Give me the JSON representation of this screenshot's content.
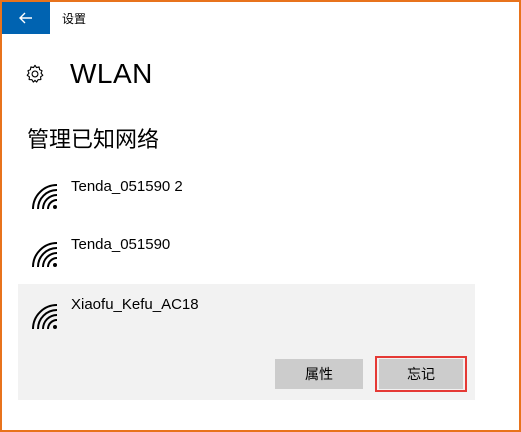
{
  "titlebar": {
    "title": "设置"
  },
  "header": {
    "title": "WLAN"
  },
  "section": {
    "title": "管理已知网络"
  },
  "networks": [
    {
      "name": "Tenda_051590 2"
    },
    {
      "name": "Tenda_051590"
    },
    {
      "name": "Xiaofu_Kefu_AC18"
    }
  ],
  "actions": {
    "properties": "属性",
    "forget": "忘记"
  },
  "colors": {
    "accent": "#0063b1",
    "highlight": "#e53935",
    "window_border": "#e8731c",
    "selected_bg": "#f2f2f2",
    "button_bg": "#cccccc"
  }
}
